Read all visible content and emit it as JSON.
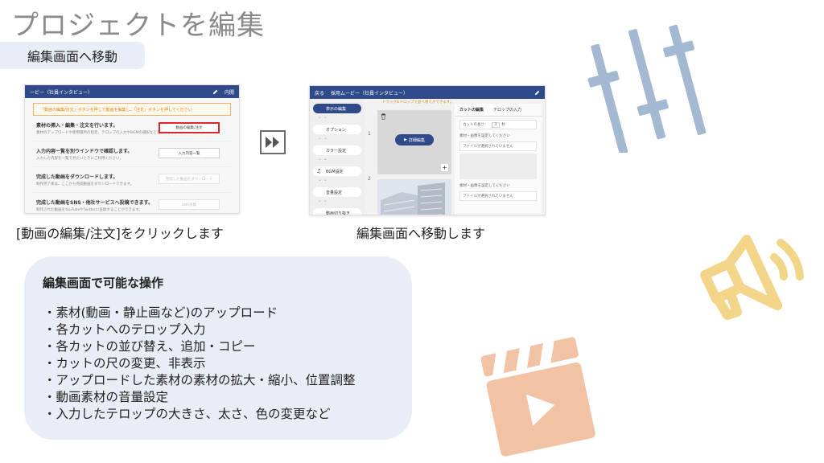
{
  "title": "プロジェクトを編集",
  "subtitle": "編集画面へ移動",
  "left_screenshot": {
    "bar_title": "ービー（社員インタビュー）",
    "bar_right": "内閲",
    "warning": "「動画の編集/注文」ボタンを押して動画を編集し、「注文」ボタンを押してください",
    "steps": [
      {
        "title": "素材の挿入・編集・注文を行います。",
        "desc": "素材のアップロードや使用箇所の指定、テロップの入力やBGMの選択などを行います。",
        "button": "動画の編集/注文"
      },
      {
        "title": "入力内容一覧を別ウインドウで確認します。",
        "desc": "入力した内容を一覧で見たいときにご利用ください。",
        "button": "入力内容一覧"
      },
      {
        "title": "完成した動画をダウンロードします。",
        "desc": "制作完了後は、ここから完成動画をダウンロードできます。",
        "button": "完成した動画をダウンロード"
      },
      {
        "title": "完成した動画をSNS・他社サービスへ投稿できます。",
        "desc": "制作された動画をYouTubeやTwitterに投稿することができます。",
        "button": "SNS投稿"
      }
    ]
  },
  "right_screenshot": {
    "bar_left": "戻る",
    "bar_title": "採用ムービー（社員インタビュー）",
    "notice": "ドラッグ&ドロップで並べ替えができます。",
    "sidebar_items": [
      "表示の編集",
      "オプション",
      "カラー設定",
      "BGM設定",
      "音量設定",
      "動画切り抜き"
    ],
    "cut_numbers": [
      "1",
      "2"
    ],
    "detail_button": "詳細編集",
    "tabs": [
      "カットの編集",
      "テロップの入力"
    ],
    "field_label": "カットの長さ：",
    "field_value": "3",
    "field_unit": "秒",
    "material_label": "素材・画像を設定してください",
    "material_placeholder": "ファイルが選択されていません"
  },
  "caption_left": "[動画の編集/注文]をクリックします",
  "caption_right": "編集画面へ移動します",
  "panel": {
    "heading": "編集画面で可能な操作",
    "items": [
      "・素材(動画・静止画など)のアップロード",
      "・各カットへのテロップ入力",
      "・各カットの並び替え、追加・コピー",
      "・カットの尺の変更、非表示",
      "・アップロードした素材の素材の拡大・縮小、位置調整",
      "・動画素材の音量設定",
      "・入力したテロップの大きさ、太さ、色の変更など"
    ]
  },
  "colors": {
    "title_gray": "#8a8a8a",
    "pill_bg": "#e9edf5",
    "app_navy": "#2f4a8a",
    "highlight_red": "#e0252b",
    "sliders_blue": "#a3b9d1",
    "megaphone_yellow": "#f3d58a",
    "clapper_peach": "#f2c2a4"
  },
  "icons": [
    "fast-forward-icon",
    "sliders-icon",
    "megaphone-icon",
    "clapper-icon",
    "pen-icon",
    "trash-icon",
    "play-icon",
    "plus-icon",
    "music-icon"
  ]
}
